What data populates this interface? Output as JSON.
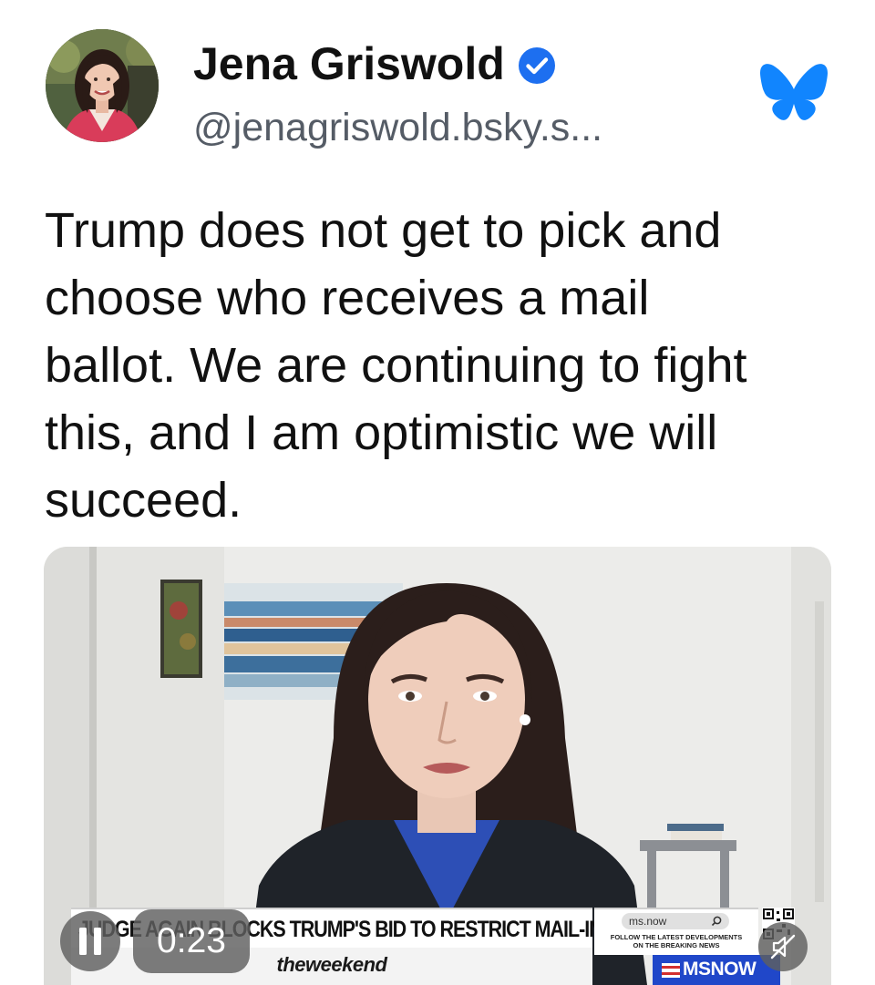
{
  "author": {
    "display_name": "Jena Griswold",
    "handle": "@jenagriswold.bsky.s...",
    "verified": true,
    "avatar_icon": "profile-photo"
  },
  "platform": {
    "icon": "bluesky-butterfly-icon",
    "color": "#1185fe"
  },
  "post": {
    "text": "Trump does not get to pick and\nchoose who receives a mail\nballot. We are continuing to fight\nthis, and I am optimistic we will\nsucceed."
  },
  "video": {
    "chyron": "JUDGE AGAIN BLOCKS TRUMP'S BID TO RESTRICT MAIL-IN VOTING",
    "show_name": "theweekend",
    "site": "ms.now",
    "follow_text": "FOLLOW THE LATEST DEVELOPMENTS\nON THE BREAKING NEWS",
    "network": "MSNOW",
    "network_color": "#2047c9",
    "elapsed": "0:23",
    "playing": true,
    "muted": true
  },
  "colors": {
    "verified_badge": "#1d6ff0",
    "handle_text": "#555c66"
  }
}
